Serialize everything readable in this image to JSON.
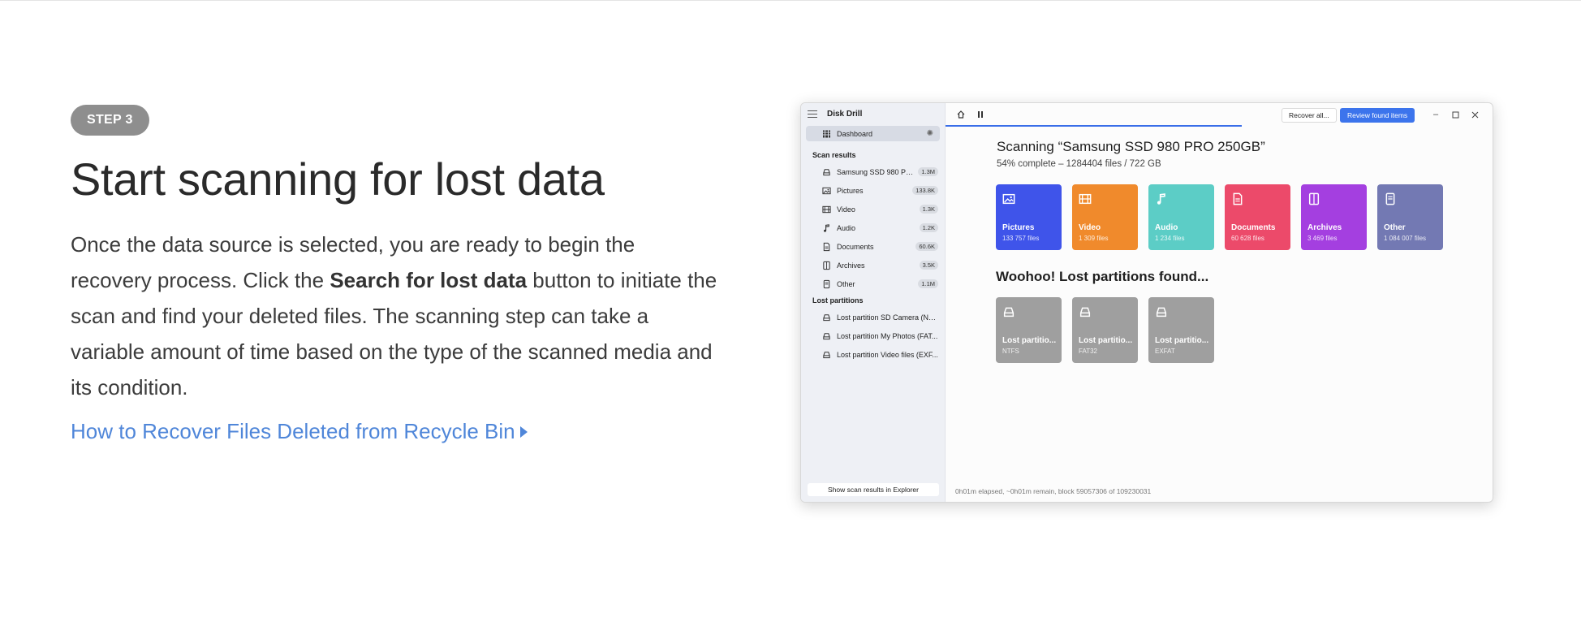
{
  "step": {
    "badge": "STEP 3"
  },
  "heading": "Start scanning for lost data",
  "body": {
    "part1": "Once the data source is selected, you are ready to begin the recovery process. Click the ",
    "bold": "Search for lost data",
    "part2": " button to initiate the scan and find your deleted files. The scanning step can take a variable amount of time based on the type of the scanned media and its condition."
  },
  "link": {
    "label": "How to Recover Files Deleted from Recycle Bin"
  },
  "app": {
    "title": "Disk Drill",
    "sidebar": {
      "dashboard_label": "Dashboard",
      "scan_results_heading": "Scan results",
      "scan_items": [
        {
          "label": "Samsung SSD 980 PRO...",
          "count": "1.3M",
          "icon": "drive-icon"
        },
        {
          "label": "Pictures",
          "count": "133.8K",
          "icon": "image-icon"
        },
        {
          "label": "Video",
          "count": "1.3K",
          "icon": "film-icon"
        },
        {
          "label": "Audio",
          "count": "1.2K",
          "icon": "music-note-icon"
        },
        {
          "label": "Documents",
          "count": "60.6K",
          "icon": "document-icon"
        },
        {
          "label": "Archives",
          "count": "3.5K",
          "icon": "archive-icon"
        },
        {
          "label": "Other",
          "count": "1.1M",
          "icon": "file-icon"
        }
      ],
      "lost_partitions_heading": "Lost partitions",
      "lost_items": [
        {
          "label": "Lost partition SD Camera (NT...",
          "icon": "drive-icon"
        },
        {
          "label": "Lost partition My Photos (FAT...",
          "icon": "drive-icon"
        },
        {
          "label": "Lost partition Video files (EXF...",
          "icon": "drive-icon"
        }
      ],
      "footer_button": "Show scan results in Explorer"
    },
    "toolbar": {
      "recover_all": "Recover all...",
      "review_found": "Review found items",
      "scan_progress_fraction": 0.54
    },
    "scan": {
      "title": "Scanning “Samsung SSD 980 PRO 250GB”",
      "subtitle": "54% complete – 1284404 files / 722 GB"
    },
    "tiles": [
      {
        "name": "Pictures",
        "sub": "133 757 files",
        "color": "#3f54ea",
        "icon": "image-icon"
      },
      {
        "name": "Video",
        "sub": "1 309 files",
        "color": "#f08a2c",
        "icon": "film-icon"
      },
      {
        "name": "Audio",
        "sub": "1 234 files",
        "color": "#5ccdc6",
        "icon": "music-note-icon"
      },
      {
        "name": "Documents",
        "sub": "60 628 files",
        "color": "#ec4a6a",
        "icon": "document-icon"
      },
      {
        "name": "Archives",
        "sub": "3 469 files",
        "color": "#a43fe0",
        "icon": "archive-icon"
      },
      {
        "name": "Other",
        "sub": "1 084 007 files",
        "color": "#7379b3",
        "icon": "file-icon"
      }
    ],
    "lost_partitions_title": "Woohoo! Lost partitions found...",
    "lost_tiles": [
      {
        "name": "Lost partitio...",
        "sub": "NTFS",
        "icon": "drive-icon"
      },
      {
        "name": "Lost partitio...",
        "sub": "FAT32",
        "icon": "drive-icon"
      },
      {
        "name": "Lost partitio...",
        "sub": "EXFAT",
        "icon": "drive-icon"
      }
    ],
    "status": "0h01m elapsed, ~0h01m remain, block 59057306 of 109230031"
  }
}
